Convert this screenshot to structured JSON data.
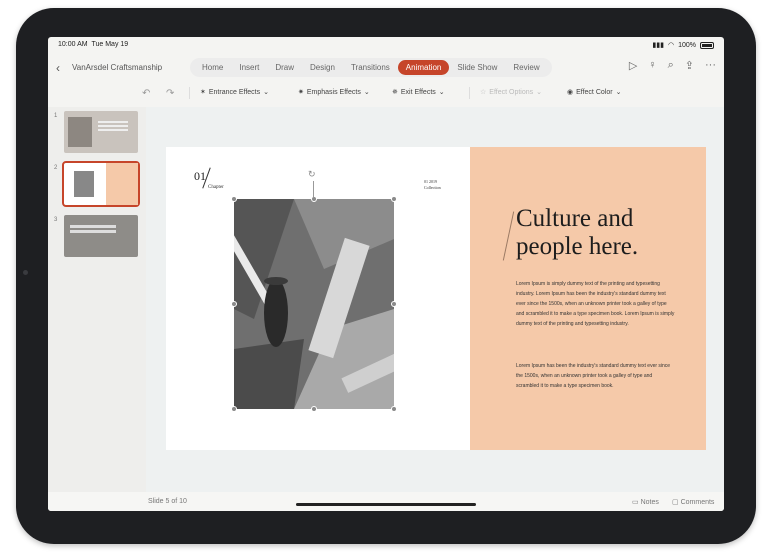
{
  "status": {
    "time": "10:00 AM",
    "date": "Tue May 19",
    "battery": "100%"
  },
  "ribbon": {
    "doc_title": "VanArsdel Craftsmanship",
    "tabs": [
      {
        "label": "Home"
      },
      {
        "label": "Insert"
      },
      {
        "label": "Draw"
      },
      {
        "label": "Design"
      },
      {
        "label": "Transitions"
      },
      {
        "label": "Animation"
      },
      {
        "label": "Slide Show"
      },
      {
        "label": "Review"
      }
    ],
    "active_tab": "Animation"
  },
  "toolbar": {
    "entrance": "Entrance Effects",
    "emphasis": "Emphasis Effects",
    "exit": "Exit Effects",
    "options": "Effect Options",
    "color": "Effect Color"
  },
  "thumbs": [
    {
      "num": "1"
    },
    {
      "num": "2"
    },
    {
      "num": "3"
    }
  ],
  "slide": {
    "chapter_num": "01",
    "chapter_label": "Chapter",
    "collection_year": "01 2019",
    "collection_label": "Collection",
    "heading_line1": "Culture and",
    "heading_line2": "people here.",
    "para1": "Lorem Ipsum is simply dummy text of the printing and typesetting industry. Lorem Ipsum has been the industry's standard dummy text ever since the 1500s, when an unknown printer took a galley of type and scrambled it to make a type specimen book. Lorem Ipsum is simply dummy text of the printing and typesetting industry.",
    "para2": "Lorem Ipsum has been the industry's standard dummy text ever since the 1500s, when an unknown printer took a galley of type and scrambled it to make a type specimen book."
  },
  "footer": {
    "slide_count": "Slide 5 of 10",
    "notes": "Notes",
    "comments": "Comments"
  },
  "colors": {
    "accent": "#c6452a",
    "panel": "#f5c9a9"
  }
}
